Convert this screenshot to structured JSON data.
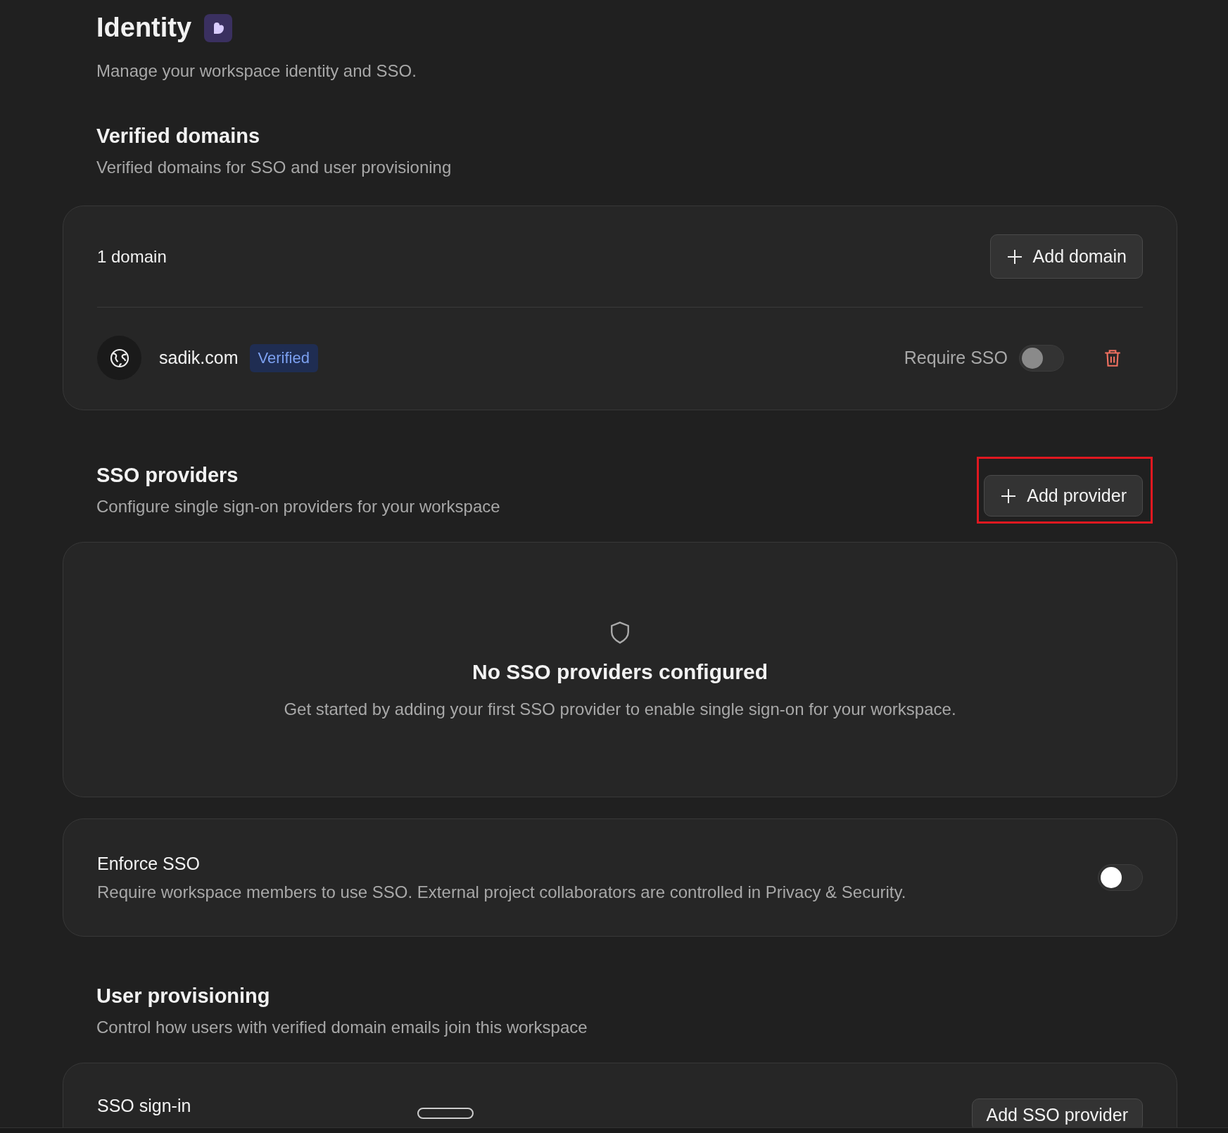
{
  "page": {
    "title": "Identity",
    "subtitle": "Manage your workspace identity and SSO."
  },
  "verified_domains": {
    "title": "Verified domains",
    "description": "Verified domains for SSO and user provisioning",
    "count": "1 domain",
    "add_button": "Add domain",
    "domains": [
      {
        "name": "sadik.com",
        "badge": "Verified",
        "require_sso_label": "Require SSO",
        "require_sso": {
          "on": false,
          "disabled": true
        }
      }
    ]
  },
  "sso_providers": {
    "title": "SSO providers",
    "description": "Configure single sign-on providers for your workspace",
    "add_button": {
      "label": "Add provider",
      "highlighted": true
    },
    "empty_title": "No SSO providers configured",
    "empty_text": "Get started by adding your first SSO provider to enable single sign-on for your workspace."
  },
  "enforce_sso": {
    "title": "Enforce SSO",
    "description": "Require workspace members to use SSO. External project collaborators are controlled in Privacy & Security.",
    "on": false,
    "disabled": false
  },
  "user_provisioning": {
    "title": "User provisioning",
    "description": "Control how users with verified domain emails join this workspace",
    "row_title": "SSO sign-in",
    "row_button": "Add SSO provider"
  }
}
